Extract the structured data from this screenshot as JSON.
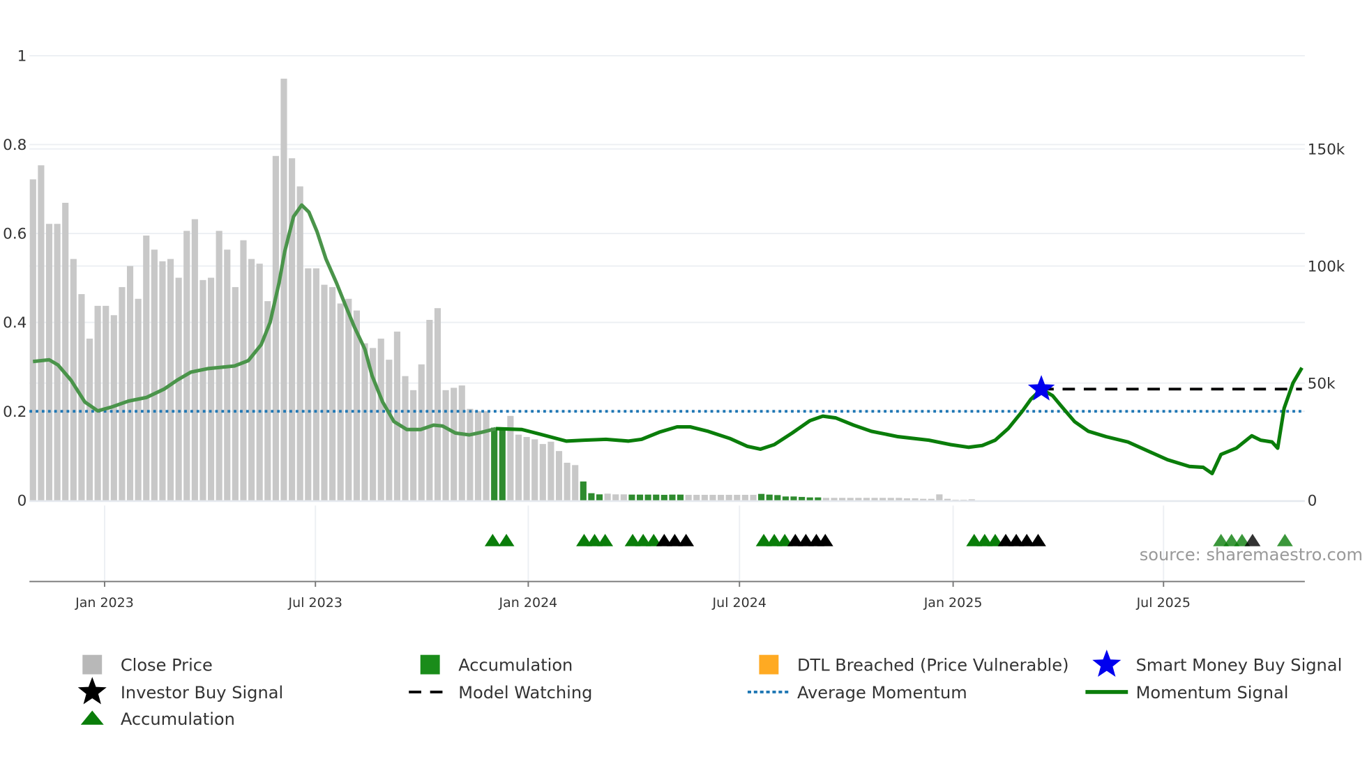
{
  "chart_data": {
    "type": "bar+line",
    "title": "",
    "source": "source: sharemaestro.com",
    "x_unit": "week index (0 = first bar, ~Oct 31 2022)",
    "x_ticks": [
      {
        "label": "Jan 2023",
        "week": 8.85
      },
      {
        "label": "Jul 2023",
        "week": 34.9
      },
      {
        "label": "Jan 2024",
        "week": 61.2
      },
      {
        "label": "Jul 2024",
        "week": 87.3
      },
      {
        "label": "Jan 2025",
        "week": 113.7
      },
      {
        "label": "Jul 2025",
        "week": 139.7
      }
    ],
    "y_left": {
      "ticks": [
        "0",
        "0.2",
        "0.4",
        "0.6",
        "0.8",
        "1"
      ],
      "values": [
        0,
        0.2,
        0.4,
        0.6,
        0.8,
        1
      ],
      "range": [
        0,
        1
      ]
    },
    "y_right": {
      "ticks": [
        "0",
        "50k",
        "100k",
        "150k"
      ],
      "values": [
        0,
        50,
        100,
        150
      ],
      "unit": "thousands",
      "range": [
        0,
        190
      ]
    },
    "close_price_k": [
      137,
      143,
      118,
      118,
      127,
      103,
      88,
      69,
      83,
      83,
      79,
      91,
      100,
      86,
      113,
      107,
      102,
      103,
      95,
      115,
      120,
      94,
      95,
      115,
      107,
      91,
      111,
      103,
      101,
      85,
      147,
      180,
      146,
      134,
      99,
      99,
      92,
      91,
      84,
      86,
      81,
      67,
      65,
      69,
      60,
      72,
      53,
      47,
      58,
      77,
      82,
      47,
      48,
      49,
      39,
      38,
      38,
      31,
      30,
      36,
      28,
      27,
      26,
      24,
      25,
      21,
      16,
      15,
      8,
      3,
      2.5,
      2.8,
      2.5,
      2.5,
      2.4,
      2.4,
      2.4,
      2.4,
      2.3,
      2.4,
      2.4,
      2.3,
      2.3,
      2.3,
      2.3,
      2.3,
      2.3,
      2.3,
      2.3,
      2.3,
      2.7,
      2.4,
      2.2,
      1.6,
      1.6,
      1.4,
      1.2,
      1.2,
      1.0,
      1.0,
      1.0,
      1.0,
      1.0,
      1.0,
      1.0,
      1.0,
      1.0,
      1.0,
      0.8,
      0.8,
      0.6,
      0.6,
      2.5,
      0.6,
      0.2,
      0.2,
      0.4
    ],
    "accumulation_bars": [
      57,
      58,
      68,
      69,
      70,
      74,
      75,
      76,
      77,
      78,
      79,
      80,
      90,
      91,
      92,
      93,
      94,
      95,
      96,
      97
    ],
    "momentum_signal": [
      [
        0,
        0.312
      ],
      [
        2.0,
        0.316
      ],
      [
        3.1,
        0.304
      ],
      [
        4.7,
        0.27
      ],
      [
        6.4,
        0.221
      ],
      [
        8.0,
        0.201
      ],
      [
        9.6,
        0.209
      ],
      [
        11.8,
        0.223
      ],
      [
        14.0,
        0.231
      ],
      [
        16.2,
        0.25
      ],
      [
        17.8,
        0.27
      ],
      [
        19.5,
        0.288
      ],
      [
        21.6,
        0.296
      ],
      [
        24.9,
        0.302
      ],
      [
        26.6,
        0.314
      ],
      [
        28.2,
        0.35
      ],
      [
        29.3,
        0.4
      ],
      [
        30.4,
        0.489
      ],
      [
        31.1,
        0.559
      ],
      [
        32.2,
        0.638
      ],
      [
        33.2,
        0.664
      ],
      [
        34.1,
        0.648
      ],
      [
        35.1,
        0.604
      ],
      [
        36.2,
        0.543
      ],
      [
        37.5,
        0.489
      ],
      [
        38.6,
        0.439
      ],
      [
        39.7,
        0.39
      ],
      [
        41.0,
        0.34
      ],
      [
        41.9,
        0.28
      ],
      [
        43.2,
        0.221
      ],
      [
        44.6,
        0.177
      ],
      [
        46.2,
        0.159
      ],
      [
        47.9,
        0.159
      ],
      [
        49.5,
        0.169
      ],
      [
        50.6,
        0.167
      ],
      [
        52.2,
        0.151
      ],
      [
        53.9,
        0.147
      ],
      [
        55.5,
        0.153
      ],
      [
        57.2,
        0.161
      ],
      [
        60.4,
        0.159
      ],
      [
        62.6,
        0.149
      ],
      [
        65.9,
        0.133
      ],
      [
        68.1,
        0.135
      ],
      [
        70.8,
        0.137
      ],
      [
        73.6,
        0.133
      ],
      [
        75.2,
        0.137
      ],
      [
        77.4,
        0.153
      ],
      [
        79.6,
        0.165
      ],
      [
        81.2,
        0.165
      ],
      [
        83.4,
        0.155
      ],
      [
        86.1,
        0.139
      ],
      [
        88.3,
        0.121
      ],
      [
        89.9,
        0.115
      ],
      [
        91.6,
        0.125
      ],
      [
        93.8,
        0.151
      ],
      [
        96.0,
        0.179
      ],
      [
        97.6,
        0.189
      ],
      [
        99.2,
        0.185
      ],
      [
        101.4,
        0.169
      ],
      [
        103.6,
        0.155
      ],
      [
        106.9,
        0.143
      ],
      [
        110.7,
        0.135
      ],
      [
        113.4,
        0.125
      ],
      [
        115.6,
        0.119
      ],
      [
        117.3,
        0.123
      ],
      [
        118.9,
        0.135
      ],
      [
        120.5,
        0.161
      ],
      [
        122.2,
        0.199
      ],
      [
        123.3,
        0.227
      ],
      [
        124.6,
        0.25
      ],
      [
        126.0,
        0.235
      ],
      [
        127.1,
        0.211
      ],
      [
        128.7,
        0.177
      ],
      [
        130.4,
        0.155
      ],
      [
        132.6,
        0.143
      ],
      [
        135.3,
        0.131
      ],
      [
        138.0,
        0.109
      ],
      [
        140.2,
        0.091
      ],
      [
        142.9,
        0.076
      ],
      [
        144.6,
        0.074
      ],
      [
        145.7,
        0.06
      ],
      [
        146.8,
        0.103
      ],
      [
        148.7,
        0.117
      ],
      [
        150.6,
        0.145
      ],
      [
        151.7,
        0.135
      ],
      [
        153.1,
        0.131
      ],
      [
        153.8,
        0.117
      ],
      [
        154.6,
        0.207
      ],
      [
        155.7,
        0.264
      ],
      [
        156.8,
        0.298
      ]
    ],
    "average_momentum": 0.2,
    "smart_money_buy_signal": {
      "week": 124.6,
      "value": 0.25
    },
    "model_watching": {
      "from_week": 124.6,
      "to_week": 156.8,
      "value": 0.25
    },
    "signals": [
      {
        "week": 56.8,
        "type": "accumulation"
      },
      {
        "week": 58.5,
        "type": "accumulation"
      },
      {
        "week": 68.1,
        "type": "accumulation"
      },
      {
        "week": 69.4,
        "type": "accumulation"
      },
      {
        "week": 70.7,
        "type": "accumulation"
      },
      {
        "week": 74.1,
        "type": "accumulation"
      },
      {
        "week": 75.4,
        "type": "accumulation"
      },
      {
        "week": 76.7,
        "type": "accumulation"
      },
      {
        "week": 78.0,
        "type": "investor"
      },
      {
        "week": 79.3,
        "type": "investor"
      },
      {
        "week": 80.7,
        "type": "investor"
      },
      {
        "week": 90.3,
        "type": "accumulation"
      },
      {
        "week": 91.6,
        "type": "accumulation"
      },
      {
        "week": 92.9,
        "type": "accumulation"
      },
      {
        "week": 94.2,
        "type": "investor"
      },
      {
        "week": 95.5,
        "type": "investor"
      },
      {
        "week": 96.8,
        "type": "investor"
      },
      {
        "week": 97.9,
        "type": "investor"
      },
      {
        "week": 116.3,
        "type": "accumulation"
      },
      {
        "week": 117.6,
        "type": "accumulation"
      },
      {
        "week": 118.9,
        "type": "accumulation"
      },
      {
        "week": 120.2,
        "type": "investor"
      },
      {
        "week": 121.5,
        "type": "investor"
      },
      {
        "week": 122.8,
        "type": "investor"
      },
      {
        "week": 124.2,
        "type": "investor"
      },
      {
        "week": 146.8,
        "type": "accumulation"
      },
      {
        "week": 148.1,
        "type": "accumulation"
      },
      {
        "week": 149.4,
        "type": "accumulation"
      },
      {
        "week": 150.7,
        "type": "investor"
      },
      {
        "week": 154.7,
        "type": "accumulation"
      }
    ],
    "colors": {
      "close": "#c8c8c8",
      "accumulation_bar": "#2e8b2e",
      "momentum": "#0a7d0a",
      "momentum_early": "#4a944a",
      "avg": "#1f77b4",
      "star": "#0000ee",
      "investor": "#000000",
      "dtl": "#ffaa22",
      "grid": "#eceff3"
    },
    "legend": [
      {
        "label": "Close Price",
        "icon": "gray-square"
      },
      {
        "label": "Accumulation",
        "icon": "green-square"
      },
      {
        "label": "DTL Breached (Price Vulnerable)",
        "icon": "orange-square"
      },
      {
        "label": "Smart Money Buy Signal",
        "icon": "blue-star"
      },
      {
        "label": "Investor Buy Signal",
        "icon": "black-star"
      },
      {
        "label": "Model Watching",
        "icon": "black-dash"
      },
      {
        "label": "Average Momentum",
        "icon": "blue-dotted"
      },
      {
        "label": "Momentum Signal",
        "icon": "green-line"
      },
      {
        "label": "Accumulation",
        "icon": "green-triangle"
      }
    ],
    "legend_placement": "bottom"
  }
}
